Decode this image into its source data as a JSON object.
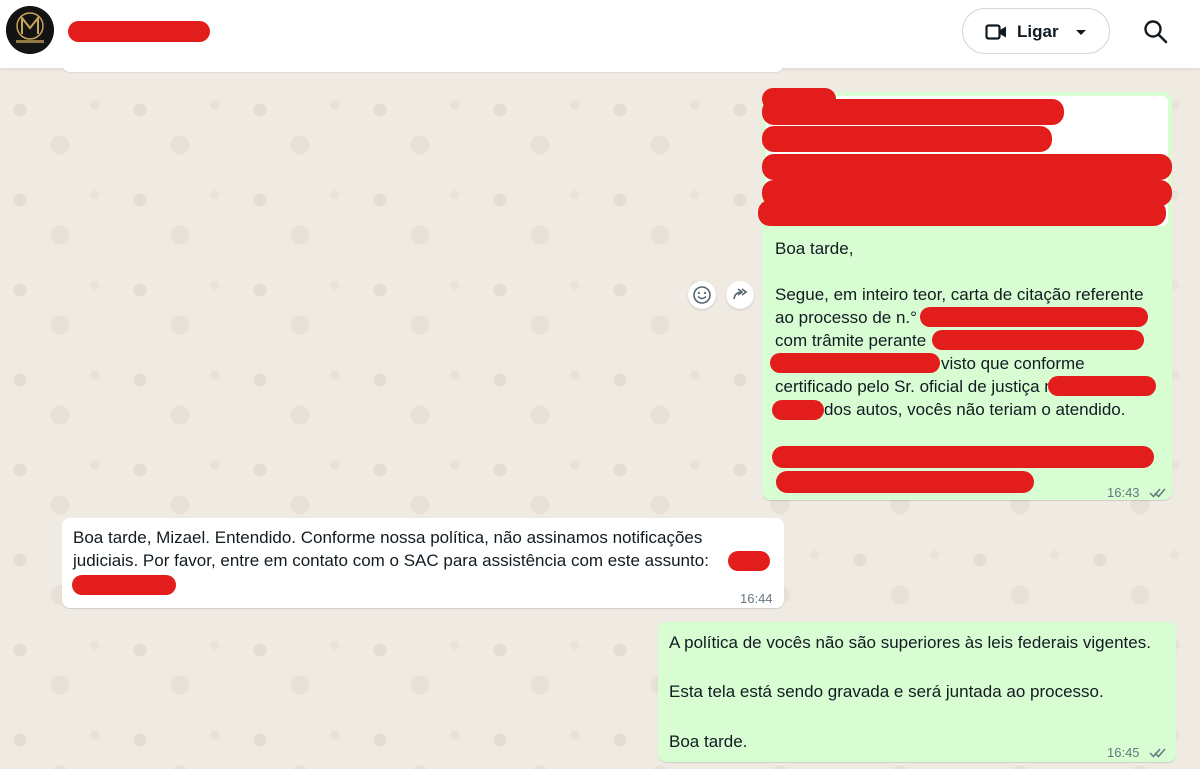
{
  "header": {
    "call_label": "Ligar",
    "avatar_icon": "brand-logo-avatar",
    "camera_icon": "video-camera-icon",
    "dropdown_icon": "caret-down-icon",
    "search_icon": "search-icon"
  },
  "messages": [
    {
      "direction": "outgoing",
      "lines": [
        "Boa tarde,",
        "Segue, em inteiro teor, carta de citação referente",
        "ao processo de n.°",
        "com trâmite perante",
        "visto que conforme",
        "certificado pelo Sr. oficial de justiça no",
        "dos autos, vocês não teriam o atendido."
      ],
      "time": "16:43",
      "status": "read"
    },
    {
      "direction": "incoming",
      "lines": [
        "Boa tarde, Mizael. Entendido. Conforme nossa política, não assinamos notificações",
        "judiciais. Por favor, entre em contato com o SAC para assistência com este assunto:"
      ],
      "time": "16:44"
    },
    {
      "direction": "outgoing",
      "lines": [
        "A política de vocês não são superiores às leis federais vigentes.",
        "Esta tela está sendo gravada e será juntada ao processo.",
        "Boa tarde."
      ],
      "time": "16:45",
      "status": "read"
    }
  ],
  "hover_actions": {
    "react_icon": "emoji-smile-icon",
    "forward_icon": "forward-icon"
  },
  "colors": {
    "outgoing_bubble": "#d9fdd3",
    "incoming_bubble": "#ffffff",
    "redaction": "#e31c1c",
    "chat_background": "#efeae2"
  }
}
